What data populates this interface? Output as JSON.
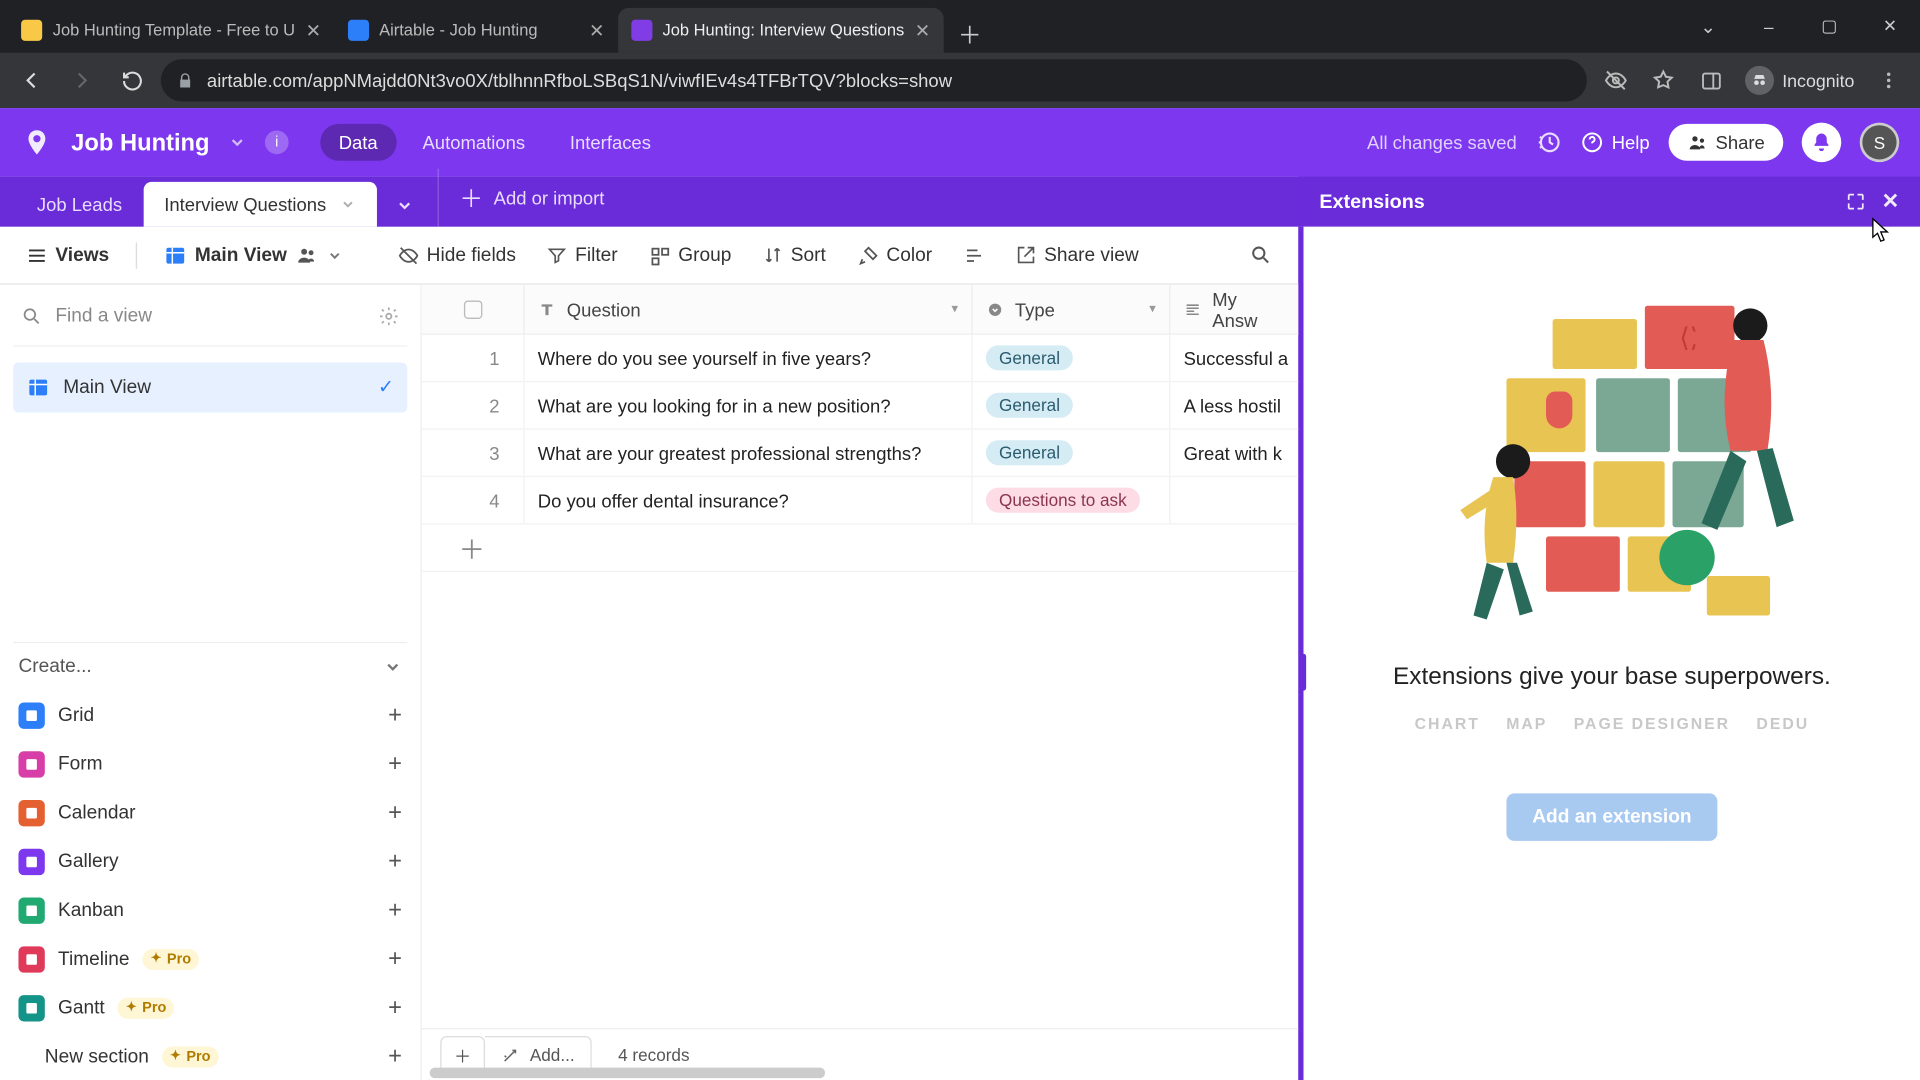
{
  "browser": {
    "tabs": [
      {
        "title": "Job Hunting Template - Free to U",
        "favicon_bg": "#f9c846"
      },
      {
        "title": "Airtable - Job Hunting",
        "favicon_bg": "#2d7ff9"
      },
      {
        "title": "Job Hunting: Interview Questions",
        "favicon_bg": "#803de6",
        "active": true
      }
    ],
    "url": "airtable.com/appNMajdd0Nt3vo0X/tblhnnRfboLSBqS1N/viwfIEv4s4TFBrTQV?blocks=show",
    "incognito_label": "Incognito",
    "window_controls": {
      "min": "–",
      "max": "▢",
      "close": "✕"
    }
  },
  "airtable": {
    "base_name": "Job Hunting",
    "top_tabs": {
      "data": "Data",
      "automations": "Automations",
      "interfaces": "Interfaces"
    },
    "status_text": "All changes saved",
    "help_label": "Help",
    "share_label": "Share",
    "avatar_initial": "S",
    "tables": {
      "inactive": "Job Leads",
      "active": "Interview Questions",
      "add_label": "Add or import"
    },
    "extensions_title": "Extensions",
    "toolbar": {
      "views": "Views",
      "main_view": "Main View",
      "hide_fields": "Hide fields",
      "filter": "Filter",
      "group": "Group",
      "sort": "Sort",
      "color": "Color",
      "share_view": "Share view"
    },
    "sidebar": {
      "search_placeholder": "Find a view",
      "active_view": "Main View",
      "create_label": "Create...",
      "items": [
        {
          "label": "Grid",
          "color": "#2d7ff9",
          "pro": false
        },
        {
          "label": "Form",
          "color": "#d83ea8",
          "pro": false
        },
        {
          "label": "Calendar",
          "color": "#e56030",
          "pro": false
        },
        {
          "label": "Gallery",
          "color": "#7c37ef",
          "pro": false
        },
        {
          "label": "Kanban",
          "color": "#20a971",
          "pro": false
        },
        {
          "label": "Timeline",
          "color": "#e03a5b",
          "pro": true
        },
        {
          "label": "Gantt",
          "color": "#149488",
          "pro": true
        }
      ],
      "new_section": "New section",
      "pro_label": "Pro"
    },
    "grid": {
      "columns": {
        "question": "Question",
        "type": "Type",
        "answer": "My Answ"
      },
      "rows": [
        {
          "n": "1",
          "q": "Where do you see yourself in five years?",
          "type": "General",
          "type_class": "general",
          "a": "Successful a"
        },
        {
          "n": "2",
          "q": "What are you looking for in a new position?",
          "type": "General",
          "type_class": "general",
          "a": "A less hostil"
        },
        {
          "n": "3",
          "q": "What are your greatest professional strengths?",
          "type": "General",
          "type_class": "general",
          "a": "Great with k"
        },
        {
          "n": "4",
          "q": "Do you offer dental insurance?",
          "type": "Questions to ask",
          "type_class": "qtoask",
          "a": ""
        }
      ],
      "footer_add": "Add...",
      "record_count": "4 records"
    },
    "ext_panel": {
      "headline": "Extensions give your base superpowers.",
      "chips": [
        "CHART",
        "MAP",
        "PAGE DESIGNER",
        "DEDU"
      ],
      "button": "Add an extension"
    }
  }
}
